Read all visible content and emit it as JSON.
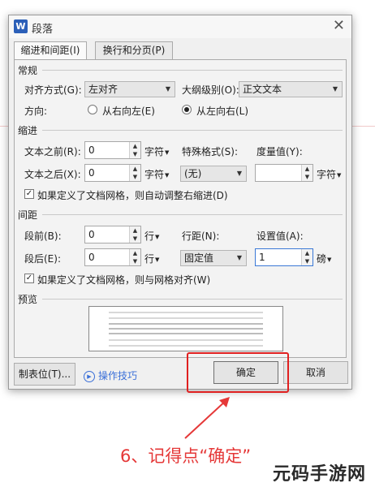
{
  "dialog": {
    "title": "段落",
    "app_icon": "W",
    "close_glyph": "✕",
    "tabs": [
      "缩进和间距(I)",
      "换行和分页(P)"
    ]
  },
  "general": {
    "section": "常规",
    "alignment_label": "对齐方式(G):",
    "alignment_value": "左对齐",
    "outline_label": "大纲级别(O):",
    "outline_value": "正文文本",
    "direction_label": "方向:",
    "rtl_label": "从右向左(E)",
    "ltr_label": "从左向右(L)",
    "direction_selected": "ltr"
  },
  "indent": {
    "section": "缩进",
    "before_label": "文本之前(R):",
    "before_value": "0",
    "after_label": "文本之后(X):",
    "after_value": "0",
    "unit": "字符",
    "special_label": "特殊格式(S):",
    "special_value": "(无)",
    "measure_label": "度量值(Y):",
    "measure_value": "",
    "measure_unit": "字符",
    "grid_checkbox_label": "如果定义了文档网格，则自动调整右缩进(D)",
    "grid_checked": true
  },
  "spacing": {
    "section": "间距",
    "before_label": "段前(B):",
    "before_value": "0",
    "after_label": "段后(E):",
    "after_value": "0",
    "unit": "行",
    "line_spacing_label": "行距(N):",
    "line_spacing_value": "固定值",
    "setting_label": "设置值(A):",
    "setting_value": "1",
    "setting_unit": "磅",
    "grid_checkbox_label": "如果定义了文档网格，则与网格对齐(W)",
    "grid_checked": true
  },
  "preview": {
    "section": "预览"
  },
  "buttons": {
    "tabs_button": "制表位(T)...",
    "tips": "操作技巧",
    "ok": "确定",
    "cancel": "取消"
  },
  "annotation": "6、记得点“确定”",
  "watermark": "元码手游网",
  "colors": {
    "highlight": "#e02020",
    "annotation": "#e53838",
    "link": "#3a6fd8",
    "app_icon": "#2b5fb8"
  }
}
